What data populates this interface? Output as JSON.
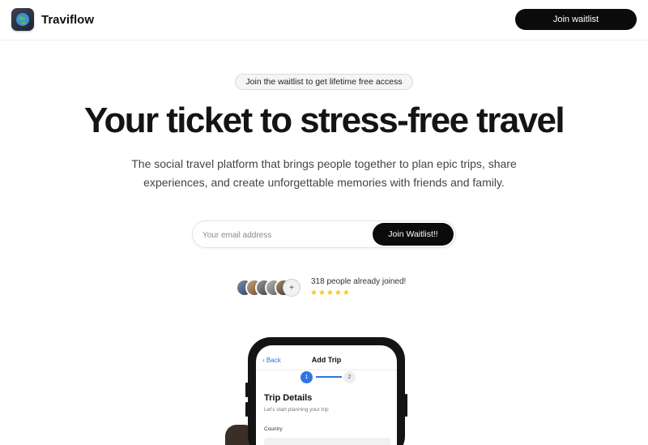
{
  "header": {
    "brand": "Traviflow",
    "cta_label": "Join waitlist"
  },
  "hero": {
    "badge": "Join the waitlist to get lifetime free access",
    "title": "Your ticket to stress-free travel",
    "subtitle": "The social travel platform that brings people together to plan epic trips, share experiences, and create unforgettable memories with friends and family."
  },
  "signup": {
    "email_placeholder": "Your email address",
    "button_label": "Join Waitlist!!"
  },
  "social_proof": {
    "more_symbol": "+",
    "joined_text": "318 people already joined!",
    "rating": 5,
    "stars": "★★★★★"
  },
  "phone_preview": {
    "back_label": "Back",
    "screen_title": "Add Trip",
    "step_current": "1",
    "step_next": "2",
    "section_title": "Trip Details",
    "section_subtitle": "Let's start planning your trip",
    "field_label": "Country"
  },
  "colors": {
    "primary_button": "#0b0b0b",
    "accent_blue": "#2f74e8",
    "star_yellow": "#f5c518"
  },
  "icons": [
    "globe-logo-icon",
    "chevron-left-icon",
    "plus-icon",
    "star-icon"
  ]
}
